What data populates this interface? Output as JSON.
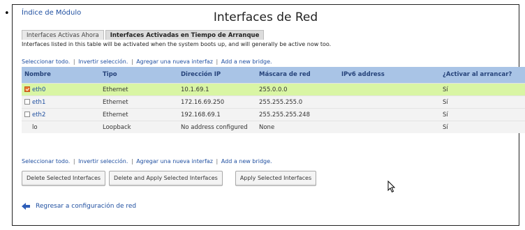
{
  "page": {
    "module_index_link": "Índice de Módulo",
    "title": "Interfaces de Red"
  },
  "tabs": [
    {
      "label": "Interfaces Activas Ahora",
      "active": false
    },
    {
      "label": "Interfaces Activadas en Tiempo de Arranque",
      "active": true
    }
  ],
  "description": "Interfaces listed in this table will be activated when the system boots up, and will generally be active now too.",
  "links": {
    "select_all": "Seleccionar todo.",
    "invert_selection": "Invertir selección.",
    "add_interface": "Agregar una nueva interfaz",
    "add_bridge": "Add a new bridge."
  },
  "table": {
    "headers": [
      "Nombre",
      "Tipo",
      "Dirección IP",
      "Máscara de red",
      "IPv6 address",
      "¿Activar al arrancar?"
    ],
    "rows": [
      {
        "name": "eth0",
        "type": "Ethernet",
        "ip": "10.1.69.1",
        "mask": "255.0.0.0",
        "ipv6": "",
        "active": "Sí",
        "checked": true,
        "highlight": true
      },
      {
        "name": "eth1",
        "type": "Ethernet",
        "ip": "172.16.69.250",
        "mask": "255.255.255.0",
        "ipv6": "",
        "active": "Sí",
        "checked": false,
        "highlight": false
      },
      {
        "name": "eth2",
        "type": "Ethernet",
        "ip": "192.168.69.1",
        "mask": "255.255.255.248",
        "ipv6": "",
        "active": "Sí",
        "checked": false,
        "highlight": false
      },
      {
        "name": "lo",
        "type": "Loopback",
        "ip": "No address configured",
        "mask": "None",
        "ipv6": "",
        "active": "Sí",
        "checked": null,
        "highlight": false
      }
    ]
  },
  "buttons": {
    "delete": "Delete Selected Interfaces",
    "delete_apply": "Delete and Apply Selected Interfaces",
    "apply": "Apply Selected Interfaces"
  },
  "back_link": "Regresar a configuración de red",
  "colors": {
    "link": "#1f4fa0",
    "header_bg": "#a9c4e6",
    "selected_row_bg": "#d9f5a4",
    "checkbox_checked": "#e8772d"
  }
}
